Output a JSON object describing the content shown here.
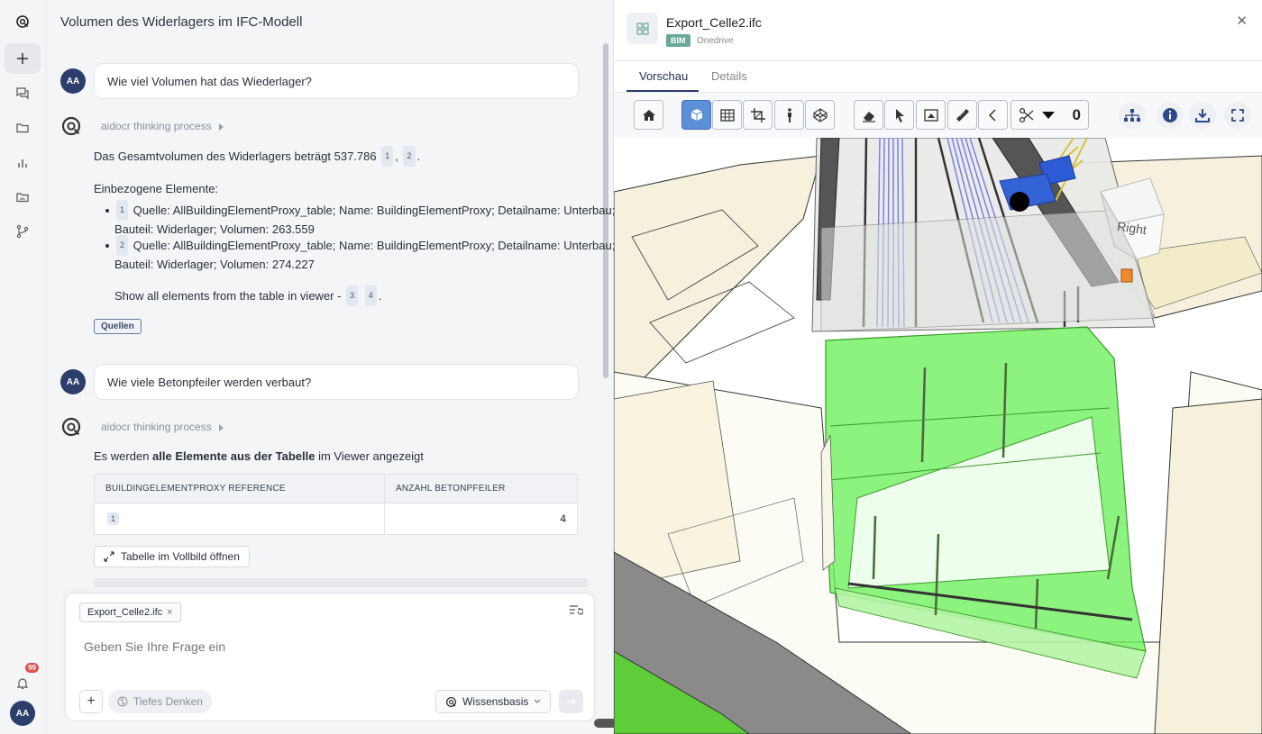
{
  "rail": {
    "items": [
      {
        "icon": "app-logo-icon"
      },
      {
        "icon": "plus-icon"
      },
      {
        "icon": "chat-icon"
      },
      {
        "icon": "folder-icon"
      },
      {
        "icon": "chart-icon"
      },
      {
        "icon": "data-folder-icon"
      },
      {
        "icon": "branch-icon"
      }
    ],
    "notification_count": "99",
    "user_initials": "AA"
  },
  "chat": {
    "title": "Volumen des Widerlagers im IFC-Modell",
    "messages": [
      {
        "role": "user",
        "initials": "AA",
        "text": "Wie viel Volumen hat das Wiederlager?"
      },
      {
        "role": "assistant",
        "thinking": "aidocr thinking process",
        "answer_prefix": "Das Gesamtvolumen des Widerlagers beträgt 537.786",
        "refs": [
          "1",
          "2"
        ],
        "section_title": "Einbezogene Elemente:",
        "items": [
          {
            "ref": "1",
            "line1": "Quelle: AllBuildingElementProxy_table; Name: BuildingElementProxy; Detailname: Unterbau;",
            "line2": "Bauteil: Widerlager; Volumen: 263.559"
          },
          {
            "ref": "2",
            "line1": "Quelle: AllBuildingElementProxy_table; Name: BuildingElementProxy; Detailname: Unterbau;",
            "line2": "Bauteil: Widerlager; Volumen: 274.227"
          }
        ],
        "show_all": "Show all elements from the table in viewer -",
        "show_refs": [
          "3",
          "4"
        ],
        "sources_label": "Quellen"
      },
      {
        "role": "user",
        "initials": "AA",
        "text": "Wie viele Betonpfeiler werden verbaut?"
      },
      {
        "role": "assistant",
        "thinking": "aidocr thinking process",
        "intro_prefix": "Es werden",
        "intro_bold": "alle Elemente aus der Tabelle",
        "intro_suffix": "im Viewer angezeigt",
        "table": {
          "headers": [
            "BUILDINGELEMENTPROXY REFERENCE",
            "ANZAHL BETONPFEILER"
          ],
          "rows": [
            [
              "1",
              "4"
            ]
          ]
        },
        "fullscreen_label": "Tabelle im Vollbild öffnen"
      }
    ]
  },
  "composer": {
    "attachment": "Export_Celle2.ifc",
    "placeholder": "Geben Sie Ihre Frage ein",
    "deep_thinking": "Tiefes Denken",
    "knowledge_base": "Wissensbasis"
  },
  "viewer_panel": {
    "file_name": "Export_Celle2.ifc",
    "tag": "BIM",
    "source": "Onedrive",
    "tabs": [
      "Vorschau",
      "Details"
    ],
    "active_tab": "Vorschau",
    "section_count": "0",
    "navcube_face": "Right",
    "colors": {
      "highlight": "#6cf05a",
      "accent": "#2c3e6b"
    }
  }
}
